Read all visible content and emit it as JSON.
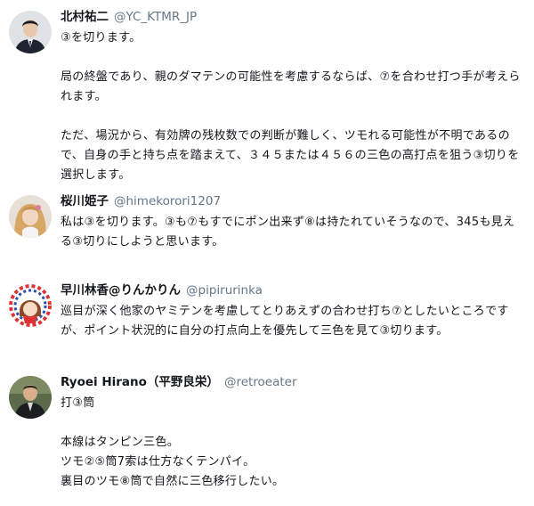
{
  "tweets": [
    {
      "name": "北村祐二",
      "handle": "@YC_KTMR_JP",
      "avatar_icon": "man-in-suit-avatar",
      "text": "③を切ります。\n\n局の終盤であり、親のダマテンの可能性を考慮するならば、⑦を合わせ打つ手が考えられます。\n\nただ、場況から、有効牌の残枚数での判断が難しく、ツモれる可能性が不明であるので、自身の手と持ち点を踏まえて、３４５または４５６の三色の高打点を狙う③切りを選択します。"
    },
    {
      "name": "桜川姫子",
      "handle": "@himekorori1207",
      "avatar_icon": "woman-with-blonde-hair-avatar",
      "text": "私は③を切ります。③も⑦もすでにポン出来ず⑧は持たれていそうなので、345も見える③切りにしようと思います。"
    },
    {
      "name": "早川林香@りんかりん",
      "handle": "@pipirurinka",
      "avatar_icon": "anime-character-avatar",
      "text": "巡目が深く他家のヤミテンを考慮してとりあえずの合わせ打ち⑦としたいところですが、ポイント状況的に自分の打点向上を優先して三色を見て③切ります。"
    },
    {
      "name": "Ryoei Hirano（平野良栄）",
      "handle": "@retroeater",
      "avatar_icon": "man-in-dark-suit-avatar",
      "text": "打③筒\n\n本線はタンピン三色。\nツモ②⑤筒7索は仕方なくテンパイ。\n裏目のツモ⑧筒で自然に三色移行したい。"
    }
  ]
}
